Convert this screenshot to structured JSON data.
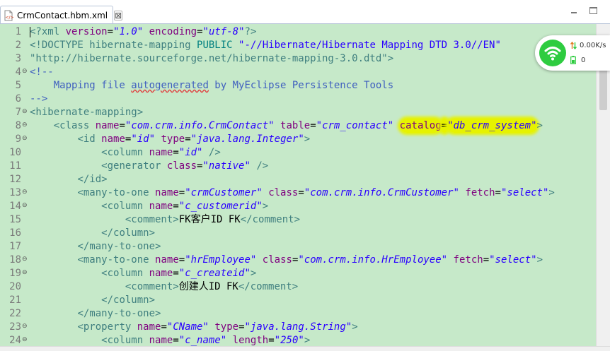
{
  "tab": {
    "title": "CrmContact.hbm.xml",
    "close_glyph": "⊠",
    "icon": "xml-file-icon"
  },
  "network_widget": {
    "speed": "0.00K/s",
    "count": "0",
    "icons": [
      "wifi-icon",
      "transfer-arrows-icon",
      "battery-icon"
    ],
    "accent": "#2ecc40"
  },
  "colors": {
    "editor_background": "#c6e9c9",
    "highlight": "#e6f200",
    "tag": "#3f7f7f",
    "attribute": "#7f007f",
    "string": "#2a00ff",
    "comment": "#3f5fbf"
  },
  "editor": {
    "lines": [
      {
        "n": "1",
        "fold": "",
        "tokens": [
          {
            "c": "cursor",
            "t": ""
          },
          {
            "c": "c-tag",
            "t": "<?"
          },
          {
            "c": "c-tag",
            "t": "xml"
          },
          {
            "c": "c-txt",
            "t": " "
          },
          {
            "c": "c-attr",
            "t": "version"
          },
          {
            "c": "c-txt",
            "t": "="
          },
          {
            "c": "c-str",
            "t": "\"1.0\""
          },
          {
            "c": "c-txt",
            "t": " "
          },
          {
            "c": "c-attr",
            "t": "encoding"
          },
          {
            "c": "c-txt",
            "t": "="
          },
          {
            "c": "c-str",
            "t": "\"utf-8\""
          },
          {
            "c": "c-tag",
            "t": "?>"
          }
        ]
      },
      {
        "n": "2",
        "fold": "",
        "tokens": [
          {
            "c": "c-tag",
            "t": "<!DOCTYPE hibernate-mapping "
          },
          {
            "c": "c-dt",
            "t": "PUBLIC"
          },
          {
            "c": "c-tag",
            "t": " "
          },
          {
            "c": "c-str-plain",
            "t": "\"-//Hibernate/Hibernate Mapping DTD 3.0//EN\""
          }
        ]
      },
      {
        "n": "3",
        "fold": "",
        "tokens": [
          {
            "c": "c-tag",
            "t": "\"http://hibernate.sourceforge.net/hibernate-mapping-3.0.dtd\">"
          }
        ]
      },
      {
        "n": "4",
        "fold": "⊖",
        "tokens": [
          {
            "c": "c-cm",
            "t": "<!--"
          }
        ]
      },
      {
        "n": "5",
        "fold": "",
        "tokens": [
          {
            "c": "c-cm",
            "t": "    Mapping file "
          },
          {
            "c": "c-cm wavy",
            "t": "autogenerated"
          },
          {
            "c": "c-cm",
            "t": " by MyEclipse Persistence Tools"
          }
        ]
      },
      {
        "n": "6",
        "fold": "",
        "tokens": [
          {
            "c": "c-cm",
            "t": "-->"
          }
        ]
      },
      {
        "n": "7",
        "fold": "⊖",
        "tokens": [
          {
            "c": "c-tag",
            "t": "<hibernate-mapping>"
          }
        ]
      },
      {
        "n": "8",
        "fold": "⊖",
        "tokens": [
          {
            "c": "c-txt",
            "t": "    "
          },
          {
            "c": "c-tag",
            "t": "<class"
          },
          {
            "c": "c-txt",
            "t": " "
          },
          {
            "c": "c-attr",
            "t": "name"
          },
          {
            "c": "c-txt",
            "t": "="
          },
          {
            "c": "c-str",
            "t": "\"com.crm.info.CrmContact\""
          },
          {
            "c": "c-txt",
            "t": " "
          },
          {
            "c": "c-attr",
            "t": "table"
          },
          {
            "c": "c-txt",
            "t": "="
          },
          {
            "c": "c-str",
            "t": "\"crm_contact\""
          },
          {
            "c": "c-txt",
            "t": " "
          },
          {
            "c": "c-attr hl",
            "t": "catalog"
          },
          {
            "c": "c-txt hl",
            "t": "="
          },
          {
            "c": "c-str hl",
            "t": "\"db_crm_system\""
          },
          {
            "c": "c-tag",
            "t": ">"
          }
        ]
      },
      {
        "n": "9",
        "fold": "⊖",
        "tokens": [
          {
            "c": "c-txt",
            "t": "        "
          },
          {
            "c": "c-tag",
            "t": "<id"
          },
          {
            "c": "c-txt",
            "t": " "
          },
          {
            "c": "c-attr",
            "t": "name"
          },
          {
            "c": "c-txt",
            "t": "="
          },
          {
            "c": "c-str",
            "t": "\"id\""
          },
          {
            "c": "c-txt",
            "t": " "
          },
          {
            "c": "c-attr",
            "t": "type"
          },
          {
            "c": "c-txt",
            "t": "="
          },
          {
            "c": "c-str",
            "t": "\"java.lang.Integer\""
          },
          {
            "c": "c-tag",
            "t": ">"
          }
        ]
      },
      {
        "n": "10",
        "fold": "",
        "tokens": [
          {
            "c": "c-txt",
            "t": "            "
          },
          {
            "c": "c-tag",
            "t": "<column"
          },
          {
            "c": "c-txt",
            "t": " "
          },
          {
            "c": "c-attr",
            "t": "name"
          },
          {
            "c": "c-txt",
            "t": "="
          },
          {
            "c": "c-str",
            "t": "\"id\""
          },
          {
            "c": "c-txt",
            "t": " "
          },
          {
            "c": "c-tag",
            "t": "/>"
          }
        ]
      },
      {
        "n": "11",
        "fold": "",
        "tokens": [
          {
            "c": "c-txt",
            "t": "            "
          },
          {
            "c": "c-tag",
            "t": "<generator"
          },
          {
            "c": "c-txt",
            "t": " "
          },
          {
            "c": "c-attr",
            "t": "class"
          },
          {
            "c": "c-txt",
            "t": "="
          },
          {
            "c": "c-str",
            "t": "\"native\""
          },
          {
            "c": "c-txt",
            "t": " "
          },
          {
            "c": "c-tag",
            "t": "/>"
          }
        ]
      },
      {
        "n": "12",
        "fold": "",
        "tokens": [
          {
            "c": "c-txt",
            "t": "        "
          },
          {
            "c": "c-tag",
            "t": "</id>"
          }
        ]
      },
      {
        "n": "13",
        "fold": "⊖",
        "tokens": [
          {
            "c": "c-txt",
            "t": "        "
          },
          {
            "c": "c-tag",
            "t": "<many-to-one"
          },
          {
            "c": "c-txt",
            "t": " "
          },
          {
            "c": "c-attr",
            "t": "name"
          },
          {
            "c": "c-txt",
            "t": "="
          },
          {
            "c": "c-str",
            "t": "\"crmCustomer\""
          },
          {
            "c": "c-txt",
            "t": " "
          },
          {
            "c": "c-attr",
            "t": "class"
          },
          {
            "c": "c-txt",
            "t": "="
          },
          {
            "c": "c-str",
            "t": "\"com.crm.info.CrmCustomer\""
          },
          {
            "c": "c-txt",
            "t": " "
          },
          {
            "c": "c-attr",
            "t": "fetch"
          },
          {
            "c": "c-txt",
            "t": "="
          },
          {
            "c": "c-str",
            "t": "\"select\""
          },
          {
            "c": "c-tag",
            "t": ">"
          }
        ]
      },
      {
        "n": "14",
        "fold": "⊖",
        "tokens": [
          {
            "c": "c-txt",
            "t": "            "
          },
          {
            "c": "c-tag",
            "t": "<column"
          },
          {
            "c": "c-txt",
            "t": " "
          },
          {
            "c": "c-attr",
            "t": "name"
          },
          {
            "c": "c-txt",
            "t": "="
          },
          {
            "c": "c-str",
            "t": "\"c_customerid\""
          },
          {
            "c": "c-tag",
            "t": ">"
          }
        ]
      },
      {
        "n": "15",
        "fold": "",
        "tokens": [
          {
            "c": "c-txt",
            "t": "                "
          },
          {
            "c": "c-tag",
            "t": "<comment>"
          },
          {
            "c": "c-txt",
            "t": "FK客户ID FK"
          },
          {
            "c": "c-tag",
            "t": "</comment>"
          }
        ]
      },
      {
        "n": "16",
        "fold": "",
        "tokens": [
          {
            "c": "c-txt",
            "t": "            "
          },
          {
            "c": "c-tag",
            "t": "</column>"
          }
        ]
      },
      {
        "n": "17",
        "fold": "",
        "tokens": [
          {
            "c": "c-txt",
            "t": "        "
          },
          {
            "c": "c-tag",
            "t": "</many-to-one>"
          }
        ]
      },
      {
        "n": "18",
        "fold": "⊖",
        "tokens": [
          {
            "c": "c-txt",
            "t": "        "
          },
          {
            "c": "c-tag",
            "t": "<many-to-one"
          },
          {
            "c": "c-txt",
            "t": " "
          },
          {
            "c": "c-attr",
            "t": "name"
          },
          {
            "c": "c-txt",
            "t": "="
          },
          {
            "c": "c-str",
            "t": "\"hrEmployee\""
          },
          {
            "c": "c-txt",
            "t": " "
          },
          {
            "c": "c-attr",
            "t": "class"
          },
          {
            "c": "c-txt",
            "t": "="
          },
          {
            "c": "c-str",
            "t": "\"com.crm.info.HrEmployee\""
          },
          {
            "c": "c-txt",
            "t": " "
          },
          {
            "c": "c-attr",
            "t": "fetch"
          },
          {
            "c": "c-txt",
            "t": "="
          },
          {
            "c": "c-str",
            "t": "\"select\""
          },
          {
            "c": "c-tag",
            "t": ">"
          }
        ]
      },
      {
        "n": "19",
        "fold": "⊖",
        "tokens": [
          {
            "c": "c-txt",
            "t": "            "
          },
          {
            "c": "c-tag",
            "t": "<column"
          },
          {
            "c": "c-txt",
            "t": " "
          },
          {
            "c": "c-attr",
            "t": "name"
          },
          {
            "c": "c-txt",
            "t": "="
          },
          {
            "c": "c-str",
            "t": "\"c_createid\""
          },
          {
            "c": "c-tag",
            "t": ">"
          }
        ]
      },
      {
        "n": "20",
        "fold": "",
        "tokens": [
          {
            "c": "c-txt",
            "t": "                "
          },
          {
            "c": "c-tag",
            "t": "<comment>"
          },
          {
            "c": "c-txt",
            "t": "创建人ID FK"
          },
          {
            "c": "c-tag",
            "t": "</comment>"
          }
        ]
      },
      {
        "n": "21",
        "fold": "",
        "tokens": [
          {
            "c": "c-txt",
            "t": "            "
          },
          {
            "c": "c-tag",
            "t": "</column>"
          }
        ]
      },
      {
        "n": "22",
        "fold": "",
        "tokens": [
          {
            "c": "c-txt",
            "t": "        "
          },
          {
            "c": "c-tag",
            "t": "</many-to-one>"
          }
        ]
      },
      {
        "n": "23",
        "fold": "⊖",
        "tokens": [
          {
            "c": "c-txt",
            "t": "        "
          },
          {
            "c": "c-tag",
            "t": "<property"
          },
          {
            "c": "c-txt",
            "t": " "
          },
          {
            "c": "c-attr",
            "t": "name"
          },
          {
            "c": "c-txt",
            "t": "="
          },
          {
            "c": "c-str",
            "t": "\"CName\""
          },
          {
            "c": "c-txt",
            "t": " "
          },
          {
            "c": "c-attr",
            "t": "type"
          },
          {
            "c": "c-txt",
            "t": "="
          },
          {
            "c": "c-str",
            "t": "\"java.lang.String\""
          },
          {
            "c": "c-tag",
            "t": ">"
          }
        ]
      },
      {
        "n": "24",
        "fold": "⊖",
        "tokens": [
          {
            "c": "c-txt",
            "t": "            "
          },
          {
            "c": "c-tag",
            "t": "<column"
          },
          {
            "c": "c-txt",
            "t": " "
          },
          {
            "c": "c-attr",
            "t": "name"
          },
          {
            "c": "c-txt",
            "t": "="
          },
          {
            "c": "c-str",
            "t": "\"c_name\""
          },
          {
            "c": "c-txt",
            "t": " "
          },
          {
            "c": "c-attr",
            "t": "length"
          },
          {
            "c": "c-txt",
            "t": "="
          },
          {
            "c": "c-str",
            "t": "\"250\""
          },
          {
            "c": "c-tag",
            "t": ">"
          }
        ]
      }
    ]
  }
}
